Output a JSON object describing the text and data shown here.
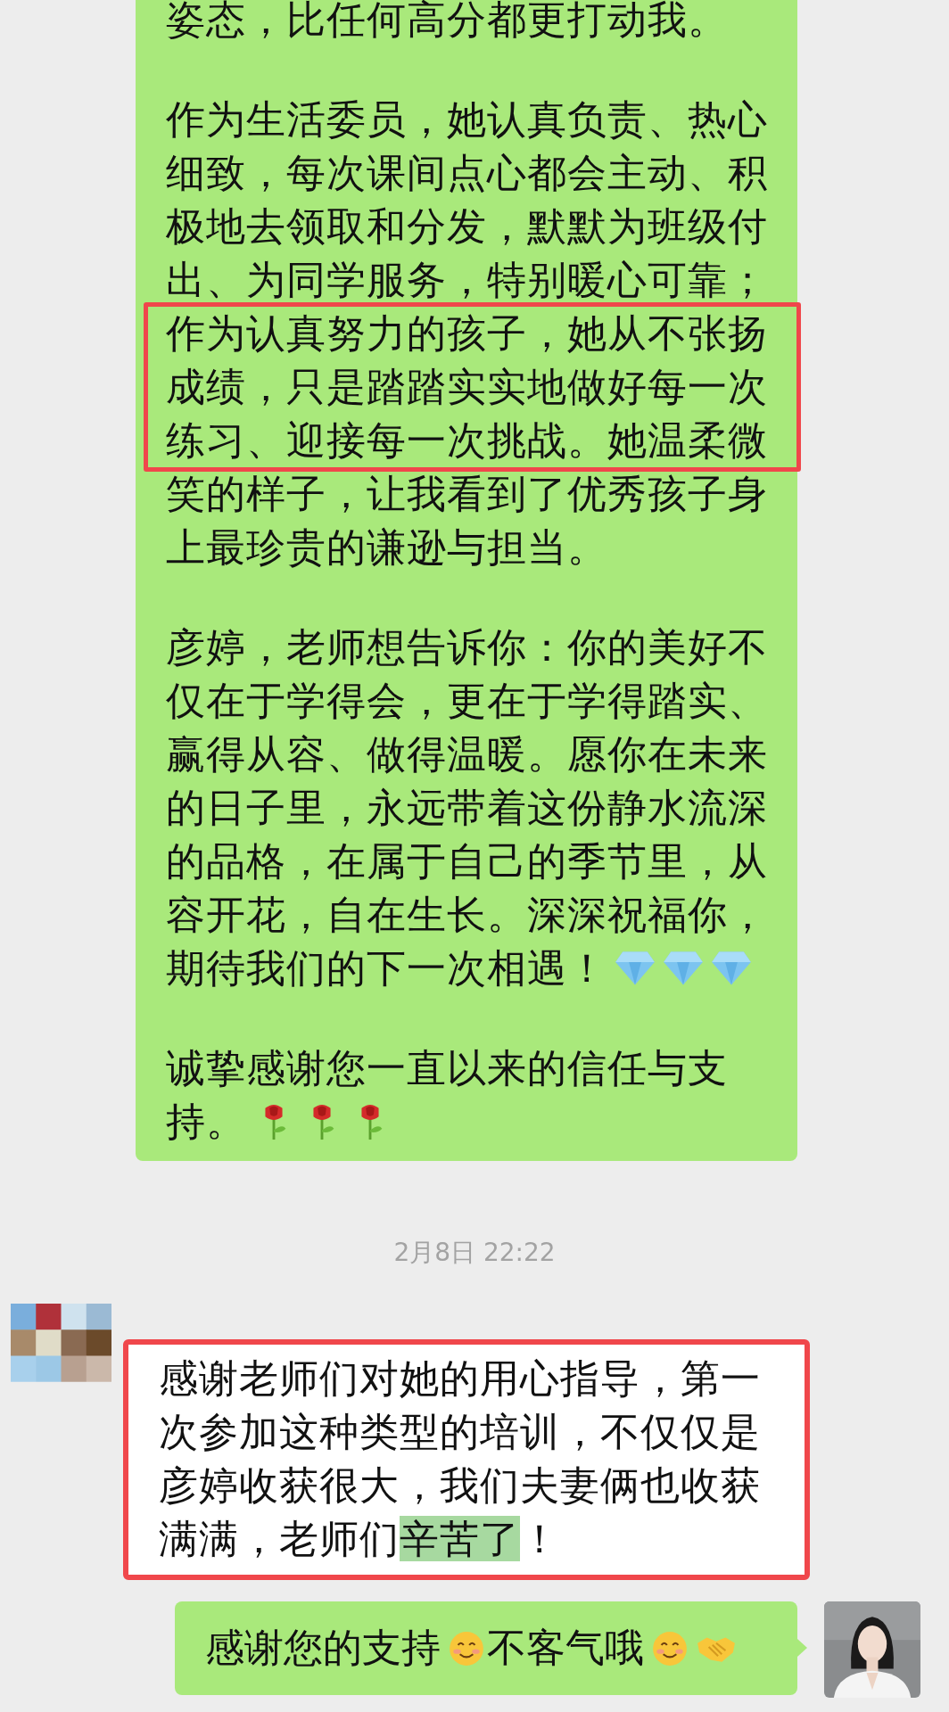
{
  "messages": [
    {
      "kind": "sent_long",
      "paragraphs": [
        {
          "lines": [
            {
              "text": "姿态，比任何高分都更打动我。",
              "boxed": false
            }
          ]
        },
        {
          "lines": [
            {
              "text": "作为生活委员，她认真负责、热心",
              "boxed": false
            },
            {
              "text": "细致，每次课间点心都会主动、积",
              "boxed": false
            },
            {
              "text": "极地去领取和分发，默默为班级付",
              "boxed": false
            },
            {
              "text": "出、为同学服务，特别暖心可靠；",
              "boxed": false
            },
            {
              "text": "作为认真努力的孩子，她从不张扬",
              "boxed": true
            },
            {
              "text": "成绩，只是踏踏实实地做好每一次",
              "boxed": true
            },
            {
              "text": "练习、迎接每一次挑战。她温柔微",
              "boxed": true
            },
            {
              "text": "笑的样子，让我看到了优秀孩子身",
              "boxed": false
            },
            {
              "text": "上最珍贵的谦逊与担当。",
              "boxed": false
            }
          ]
        },
        {
          "lines": [
            {
              "text": "彦婷，老师想告诉你：你的美好不",
              "boxed": false
            },
            {
              "text": "仅在于学得会，更在于学得踏实、",
              "boxed": false
            },
            {
              "text": "赢得从容、做得温暖。愿你在未来",
              "boxed": false
            },
            {
              "text": "的日子里，永远带着这份静水流深",
              "boxed": false
            },
            {
              "text": "的品格，在属于自己的季节里，从",
              "boxed": false
            },
            {
              "text": "容开花，自在生长。深深祝福你，",
              "boxed": false
            },
            {
              "text": "期待我们的下一次相遇！",
              "boxed": false,
              "emojis": [
                {
                  "kind": "diamond"
                },
                {
                  "kind": "diamond"
                },
                {
                  "kind": "diamond"
                }
              ]
            }
          ]
        },
        {
          "lines": [
            {
              "text": "诚挚感谢您一直以来的信任与支",
              "boxed": false
            },
            {
              "text": "持。",
              "boxed": false,
              "emojis": [
                {
                  "kind": "rose"
                },
                {
                  "kind": "rose"
                },
                {
                  "kind": "rose"
                }
              ]
            }
          ]
        }
      ]
    },
    {
      "kind": "timestamp",
      "text": "2月8日 22:22"
    },
    {
      "kind": "received",
      "boxed": true,
      "lines": [
        {
          "text": "感谢老师们对她的用心指导，第一"
        },
        {
          "text": "次参加这种类型的培训，不仅仅是"
        },
        {
          "text": "彦婷收获很大，我们夫妻俩也收获"
        },
        {
          "text": "满满，老师们",
          "highlight": "辛苦了",
          "after": "！"
        }
      ]
    },
    {
      "kind": "sent",
      "parts": [
        {
          "kind": "text",
          "text": "感谢您的支持"
        },
        {
          "kind": "smile"
        },
        {
          "kind": "text",
          "text": "不客气哦"
        },
        {
          "kind": "smile"
        },
        {
          "kind": "handshake"
        }
      ]
    }
  ]
}
